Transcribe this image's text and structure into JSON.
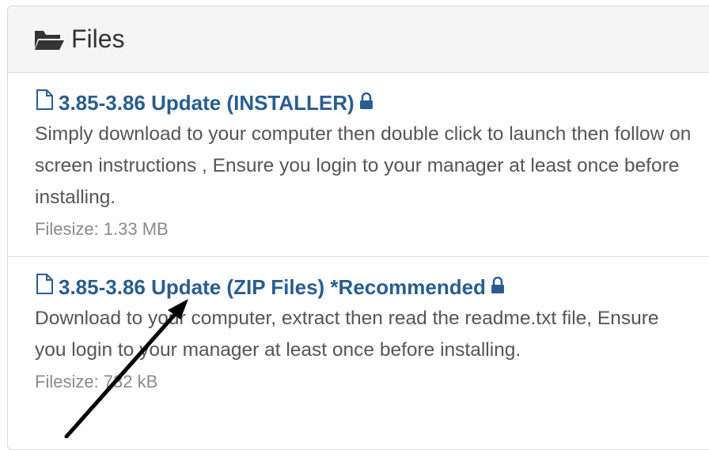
{
  "panel": {
    "title": "Files",
    "title_icon": "folder-open-icon"
  },
  "files": [
    {
      "name": "3.85-3.86 Update (INSTALLER)",
      "icon": "document-icon",
      "locked_icon": "lock-icon",
      "description": "Simply download to your computer then double click to launch then follow on screen instructions , Ensure you login to your manager at least once before installing.",
      "filesize": "Filesize: 1.33 MB"
    },
    {
      "name": "3.85-3.86 Update (ZIP Files) *Recommended",
      "icon": "document-icon",
      "locked_icon": "lock-icon",
      "description": "Download to your computer, extract then read the readme.txt file, Ensure you login to your manager at least once before installing.",
      "filesize": "Filesize: 732 kB"
    }
  ],
  "colors": {
    "link": "#2a5d8f",
    "header_bg": "#f5f5f5",
    "annotation_arrow": "#000000"
  }
}
